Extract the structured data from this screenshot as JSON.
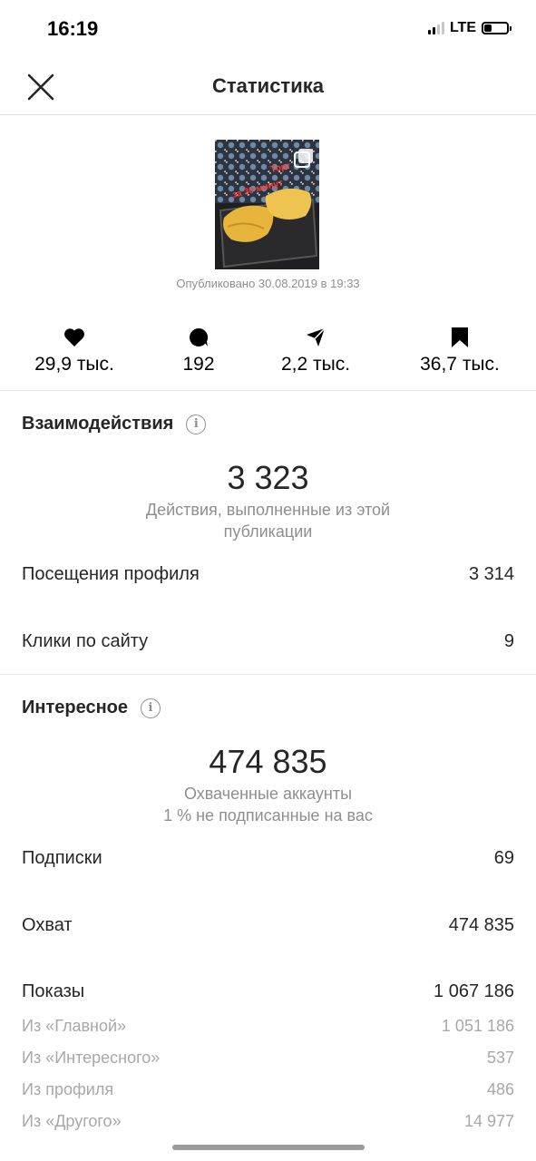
{
  "status_bar": {
    "time": "16:19",
    "network": "LTE",
    "icons": [
      "signal-icon",
      "battery-icon"
    ]
  },
  "header": {
    "title": "Статистика",
    "close_icon": "close-icon"
  },
  "post": {
    "thumbnail_text_1": "Торт",
    "thumbnail_text_2": "за 30 минут",
    "published": "Опубликовано 30.08.2019 в 19:33"
  },
  "metrics": [
    {
      "icon": "heart-icon",
      "value": "29,9 тыс."
    },
    {
      "icon": "comment-icon",
      "value": "192"
    },
    {
      "icon": "share-icon",
      "value": "2,2 тыс."
    },
    {
      "icon": "bookmark-icon",
      "value": "36,7 тыс."
    }
  ],
  "interactions": {
    "title": "Взаимодействия",
    "total": "3 323",
    "caption": "Действия, выполненные из этой публикации",
    "rows": [
      {
        "label": "Посещения профиля",
        "value": "3 314"
      },
      {
        "label": "Клики по сайту",
        "value": "9"
      }
    ]
  },
  "discovery": {
    "title": "Интересное",
    "total": "474 835",
    "caption_1": "Охваченные аккаунты",
    "caption_2": "1 % не подписанные на вас",
    "rows": [
      {
        "label": "Подписки",
        "value": "69"
      },
      {
        "label": "Охват",
        "value": "474 835"
      },
      {
        "label": "Показы",
        "value": "1 067 186"
      }
    ],
    "sub_rows": [
      {
        "label": "Из «Главной»",
        "value": "1 051 186"
      },
      {
        "label": "Из «Интересного»",
        "value": "537"
      },
      {
        "label": "Из профиля",
        "value": "486"
      },
      {
        "label": "Из «Другого»",
        "value": "14 977"
      }
    ]
  },
  "colors": {
    "text": "#262626",
    "secondary": "#8e8e8e",
    "divider": "#dbdbdb"
  }
}
